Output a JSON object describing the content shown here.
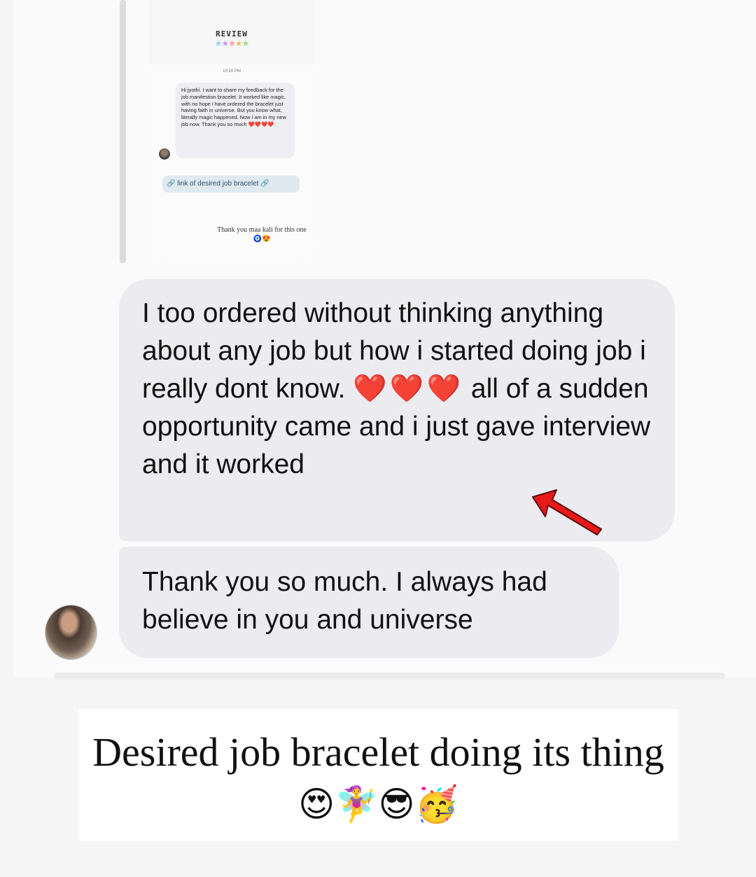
{
  "story_thumbnail": {
    "header_title": "REVIEW",
    "stars": "★★★★★",
    "star_colors": [
      "#9ad0f0",
      "#c79ce6",
      "#f59ab0",
      "#f5c061",
      "#a2d88a"
    ],
    "timestamp": "10:20 PM",
    "message": "Hi jyothi. I want to share my feedback for the job manifestion bracelet. It worked like magic, with no hope i have ordered the bracelet just having faith in universe. But you know what, literally magic happened. Now i am in my new job now. Thank you so much",
    "message_emoji": "❤️❤️❤️❤️",
    "link_label": "🔗 link of desired job bracelet 🔗",
    "footer_text": "Thank you maa kali for this one 🧿😍"
  },
  "messages": [
    {
      "text_part1": "I too ordered without thinking anything about any job but how i started doing job i really dont know.",
      "hearts": "❤️❤️❤️",
      "text_part2": "all of a sudden opportunity came and i just gave interview and it worked"
    },
    {
      "text": "Thank you so much. I always had believe in you and universe"
    }
  ],
  "annotation": {
    "icon": "red-arrow-icon",
    "color": "#e8191b"
  },
  "caption": {
    "text": "Desired job bracelet doing its thing",
    "emoji": "😍🧚‍♀️😎🥳"
  }
}
